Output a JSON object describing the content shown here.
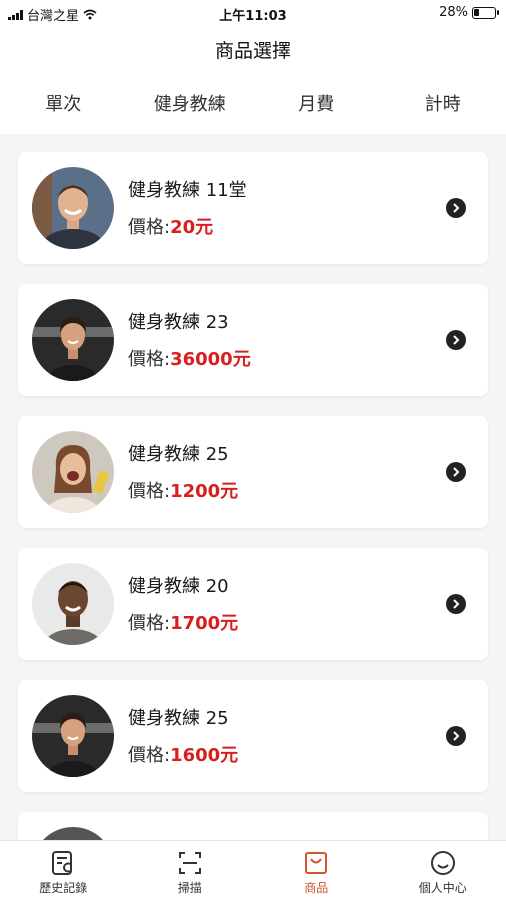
{
  "status_bar": {
    "carrier": "台灣之星",
    "time": "上午11:03",
    "battery": "28%",
    "battery_level": 0.28
  },
  "header": {
    "title": "商品選擇"
  },
  "tabs": [
    {
      "label": "單次",
      "active": false
    },
    {
      "label": "健身教練",
      "active": true
    },
    {
      "label": "月費",
      "active": false
    },
    {
      "label": "計時",
      "active": false
    }
  ],
  "products": [
    {
      "name": "健身教練 11堂",
      "price_label": "價格:",
      "price": "20元",
      "avatar": "smiling-man-portrait"
    },
    {
      "name": "健身教練 23",
      "price_label": "價格:",
      "price": "36000元",
      "avatar": "woman-gym-portrait"
    },
    {
      "name": "健身教練 25",
      "price_label": "價格:",
      "price": "1200元",
      "avatar": "laughing-woman-portrait"
    },
    {
      "name": "健身教練 20",
      "price_label": "價格:",
      "price": "1700元",
      "avatar": "bald-man-portrait"
    },
    {
      "name": "健身教練 25",
      "price_label": "價格:",
      "price": "1600元",
      "avatar": "woman-gym-portrait"
    }
  ],
  "tabbar": [
    {
      "label": "歷史記錄",
      "icon": "history-icon",
      "active": false
    },
    {
      "label": "掃描",
      "icon": "scan-icon",
      "active": false
    },
    {
      "label": "商品",
      "icon": "shopping-bag-icon",
      "active": true
    },
    {
      "label": "個人中心",
      "icon": "profile-icon",
      "active": false
    }
  ],
  "colors": {
    "accent": "#d2542a",
    "price": "#d81e1e",
    "background": "#f5f5f5"
  }
}
